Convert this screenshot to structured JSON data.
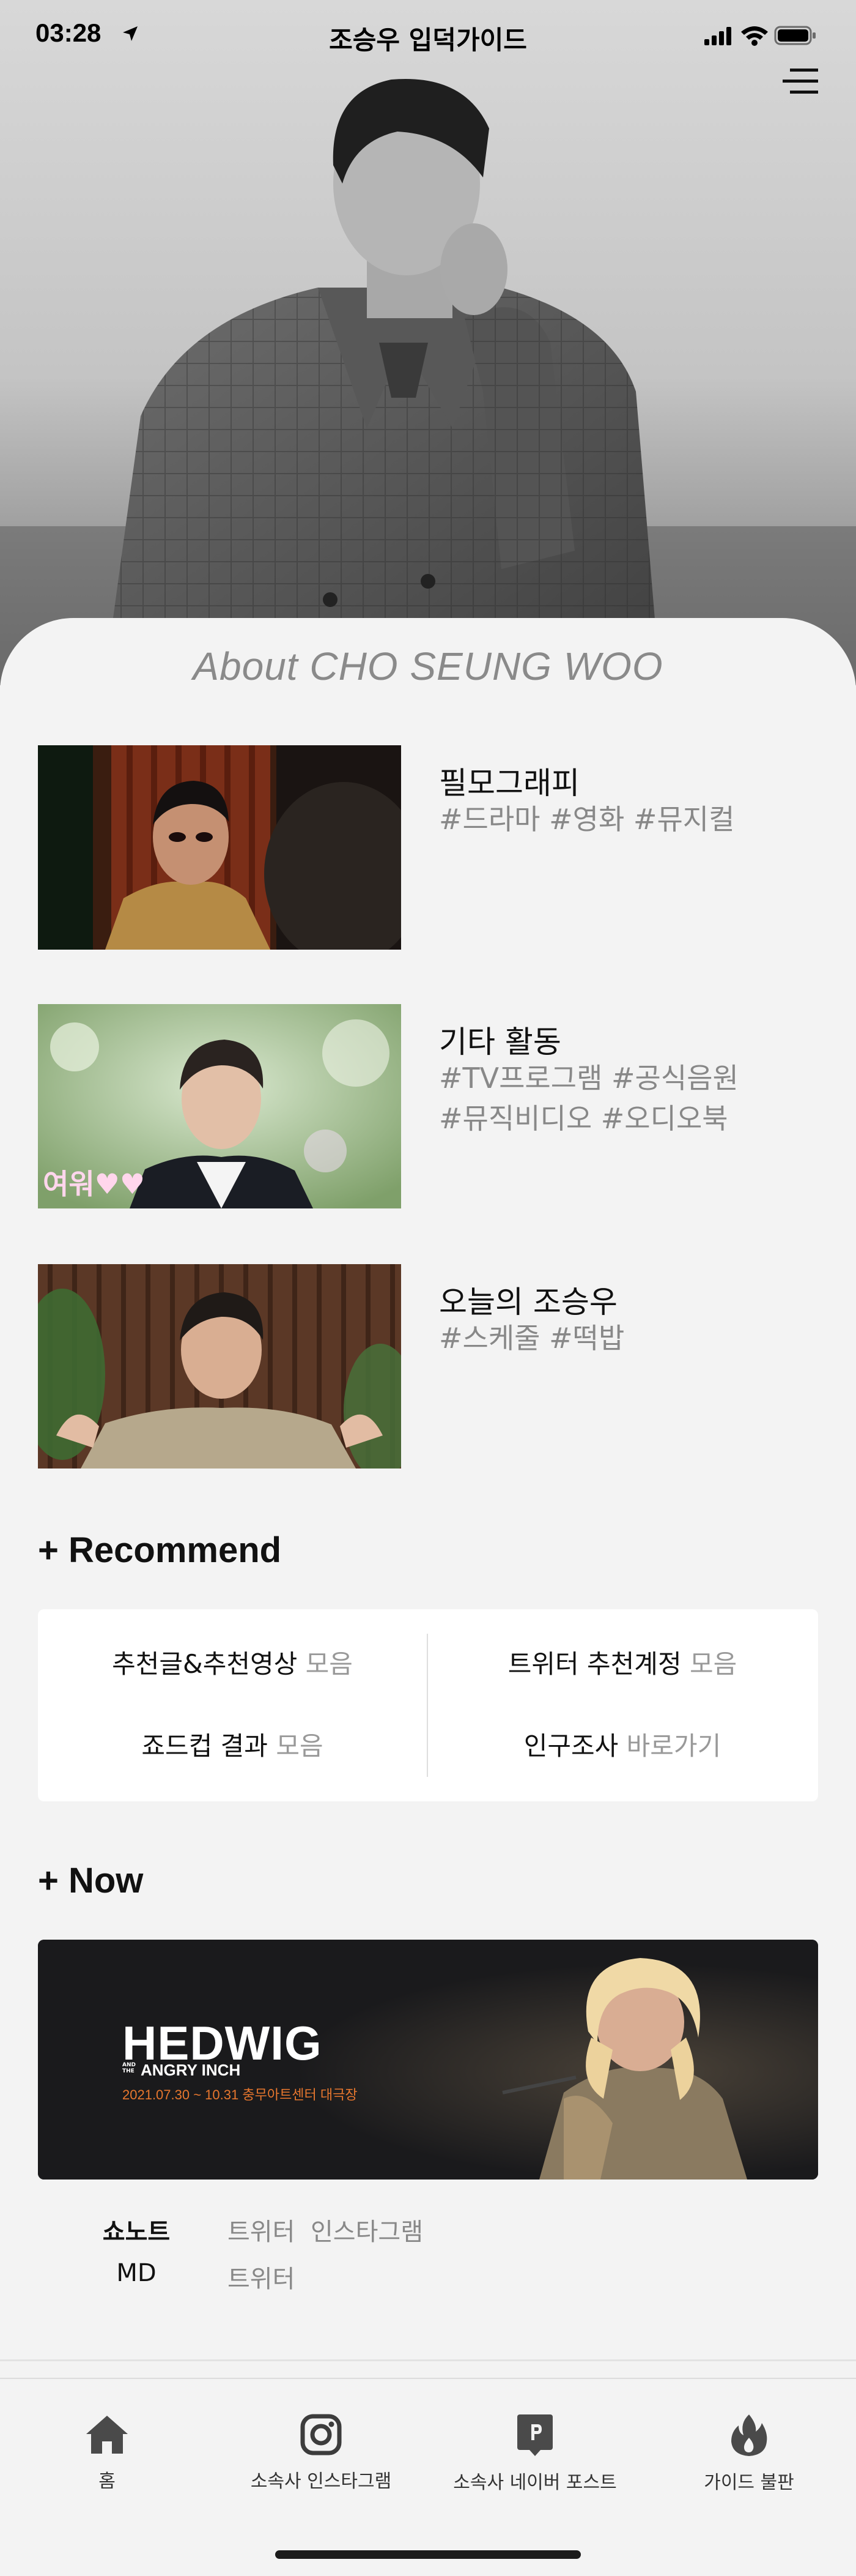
{
  "status_bar": {
    "time": "03:28",
    "title": "조승우 입덕가이드"
  },
  "about": {
    "prefix": "About",
    "name": "CHO SEUNG WOO"
  },
  "features": [
    {
      "title": "필모그래피",
      "tags_line1": "#드라마 #영화 #뮤지컬",
      "tags_line2": ""
    },
    {
      "title": "기타 활동",
      "tags_line1": "#TV프로그램 #공식음원",
      "tags_line2": "#뮤직비디오 #오디오북"
    },
    {
      "title": "오늘의 조승우",
      "tags_line1": "#스케줄 #떡밥",
      "tags_line2": ""
    }
  ],
  "thumbnail_captions": {
    "second": "여워♥♥"
  },
  "recommend": {
    "heading": "+ Recommend",
    "items": [
      {
        "main": "추천글&추천영상",
        "muted": "모음"
      },
      {
        "main": "트위터 추천계정",
        "muted": "모음"
      },
      {
        "main": "죠드컵 결과",
        "muted": "모음"
      },
      {
        "main": "인구조사",
        "muted": "바로가기"
      }
    ]
  },
  "now": {
    "heading": "+ Now",
    "banner": {
      "title": "HEDWIG",
      "sub_and": "AND THE",
      "subtitle": "ANGRY INCH",
      "date_text": "2021.07.30 ~ 10.31  충무아트센터 대극장"
    },
    "links": [
      {
        "label": "쇼노트",
        "links": [
          "트위터",
          "인스타그램"
        ]
      },
      {
        "label": "MD",
        "links": [
          "트위터"
        ]
      }
    ]
  },
  "tabbar": {
    "items": [
      {
        "label": "홈",
        "icon": "home-icon"
      },
      {
        "label": "소속사 인스타그램",
        "icon": "instagram-icon"
      },
      {
        "label": "소속사 네이버 포스트",
        "icon": "naver-post-icon"
      },
      {
        "label": "가이드 불판",
        "icon": "fire-icon"
      }
    ]
  }
}
